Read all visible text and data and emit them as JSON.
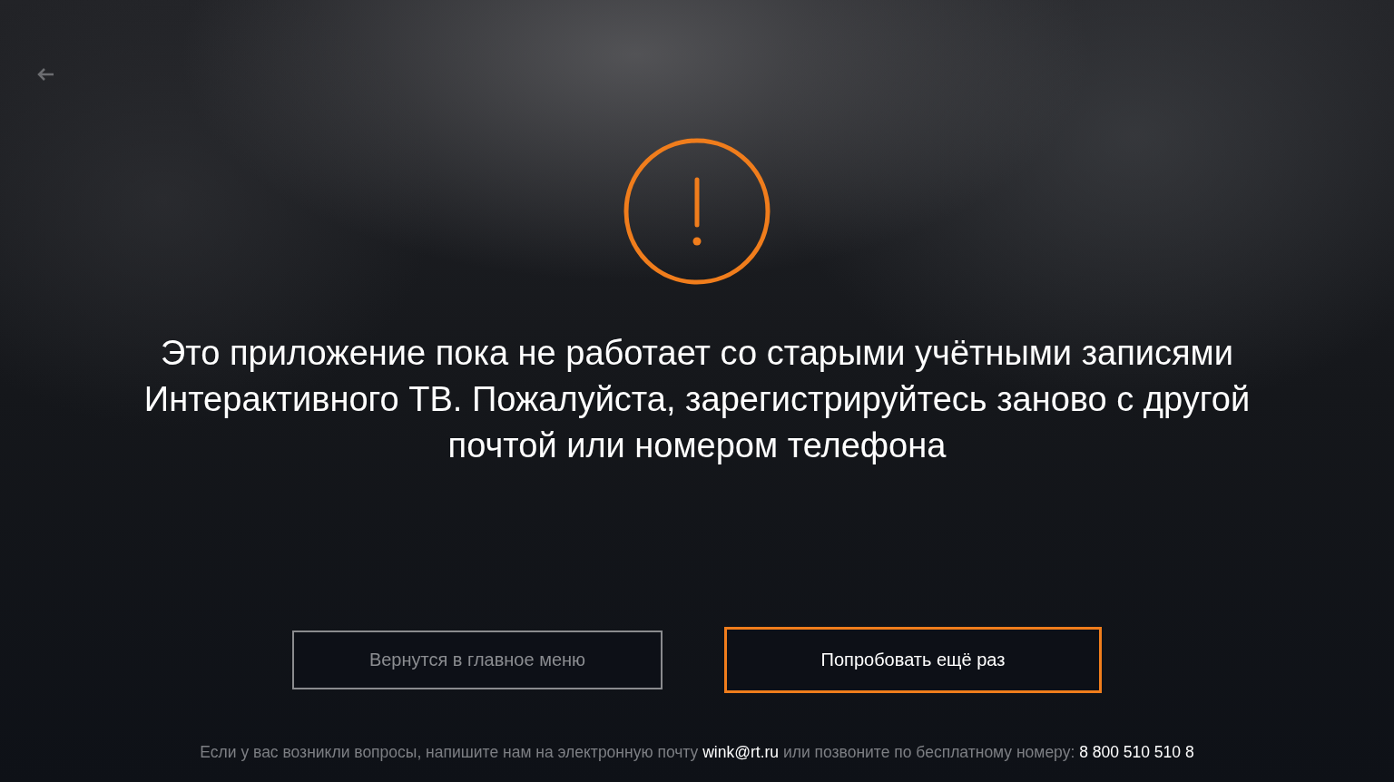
{
  "message": "Это приложение пока не работает со старыми учётными записями Интерактивного ТВ. Пожалуйста, зарегистрируйтесь заново с другой почтой или номером телефона",
  "buttons": [
    {
      "label": "Вернутся в главное меню",
      "selected": false
    },
    {
      "label": "Попробовать ещё раз",
      "selected": true
    }
  ],
  "footer": "Если у вас возникли вопросы, напишите нам на электронную почту **wink@rt.ru** или позвоните по бесплатному номеру: **8 800 510 510 8**"
}
